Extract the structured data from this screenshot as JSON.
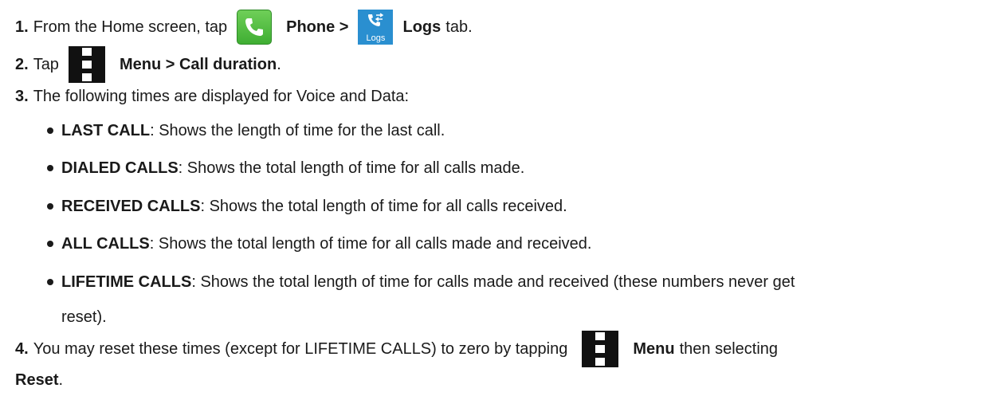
{
  "steps": {
    "s1": {
      "num": "1.",
      "pre": "From the Home screen, tap",
      "phone": "Phone >",
      "logs_icon_text": "Logs",
      "logs": "Logs",
      "post": "tab."
    },
    "s2": {
      "num": "2.",
      "pre": "Tap",
      "menu": "Menu > Call duration",
      "post": "."
    },
    "s3": {
      "num": "3.",
      "text": "The following times are displayed for Voice and Data:"
    },
    "s4": {
      "num": "4.",
      "pre": "You may reset these times (except for LIFETIME CALLS) to zero by tapping",
      "menu": "Menu",
      "mid": "then selecting",
      "reset": "Reset",
      "post": "."
    }
  },
  "bullets": [
    {
      "term": "LAST CALL",
      "desc": ": Shows the length of time for the last call."
    },
    {
      "term": "DIALED CALLS",
      "desc": ": Shows the total length of time for all calls made."
    },
    {
      "term": "RECEIVED CALLS",
      "desc": ": Shows the total length of time for all calls received."
    },
    {
      "term": "ALL CALLS",
      "desc": ": Shows the total length of time for all calls made and received."
    },
    {
      "term": "LIFETIME CALLS",
      "desc": ": Shows the total length of time for calls made and received (these numbers never get",
      "cont": "reset)."
    }
  ],
  "icons": [
    "phone-app-icon",
    "logs-tab-icon",
    "menu-icon"
  ]
}
